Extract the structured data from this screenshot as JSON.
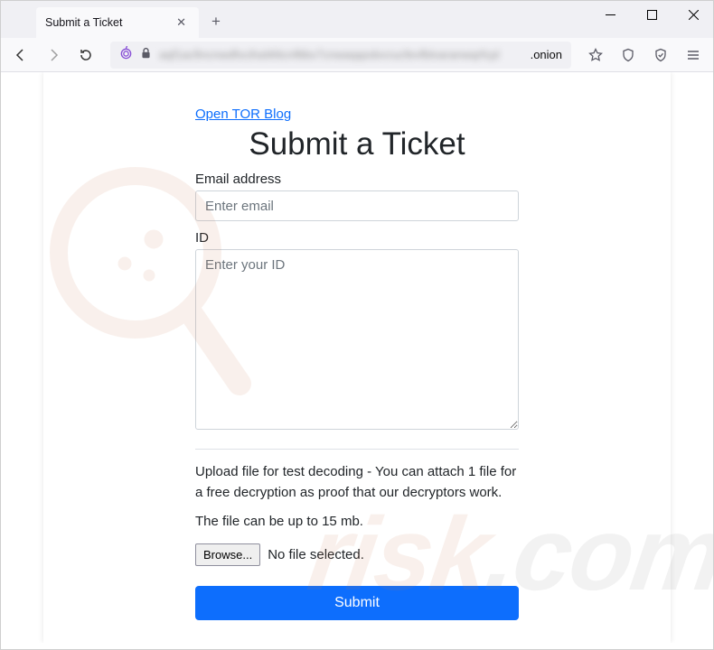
{
  "browser": {
    "tab_title": "Submit a Ticket",
    "url_blurred": "aqf1acfincnwdfxcihaWitcnfttbv7cnwaqqodvcrucfevfblvaranwqrfcpl",
    "url_suffix": ".onion"
  },
  "page": {
    "blog_link": "Open TOR Blog",
    "title": "Submit a Ticket",
    "email_label": "Email address",
    "email_placeholder": "Enter email",
    "id_label": "ID",
    "id_placeholder": "Enter your ID",
    "upload_info": "Upload file for test decoding - You can attach 1 file for a free decryption as proof that our decryptors work.",
    "size_info": "The file can be up to 15 mb.",
    "browse_label": "Browse...",
    "no_file_label": "No file selected.",
    "submit_label": "Submit"
  },
  "watermark": {
    "text_main": "risk",
    "text_suffix": ".com"
  }
}
